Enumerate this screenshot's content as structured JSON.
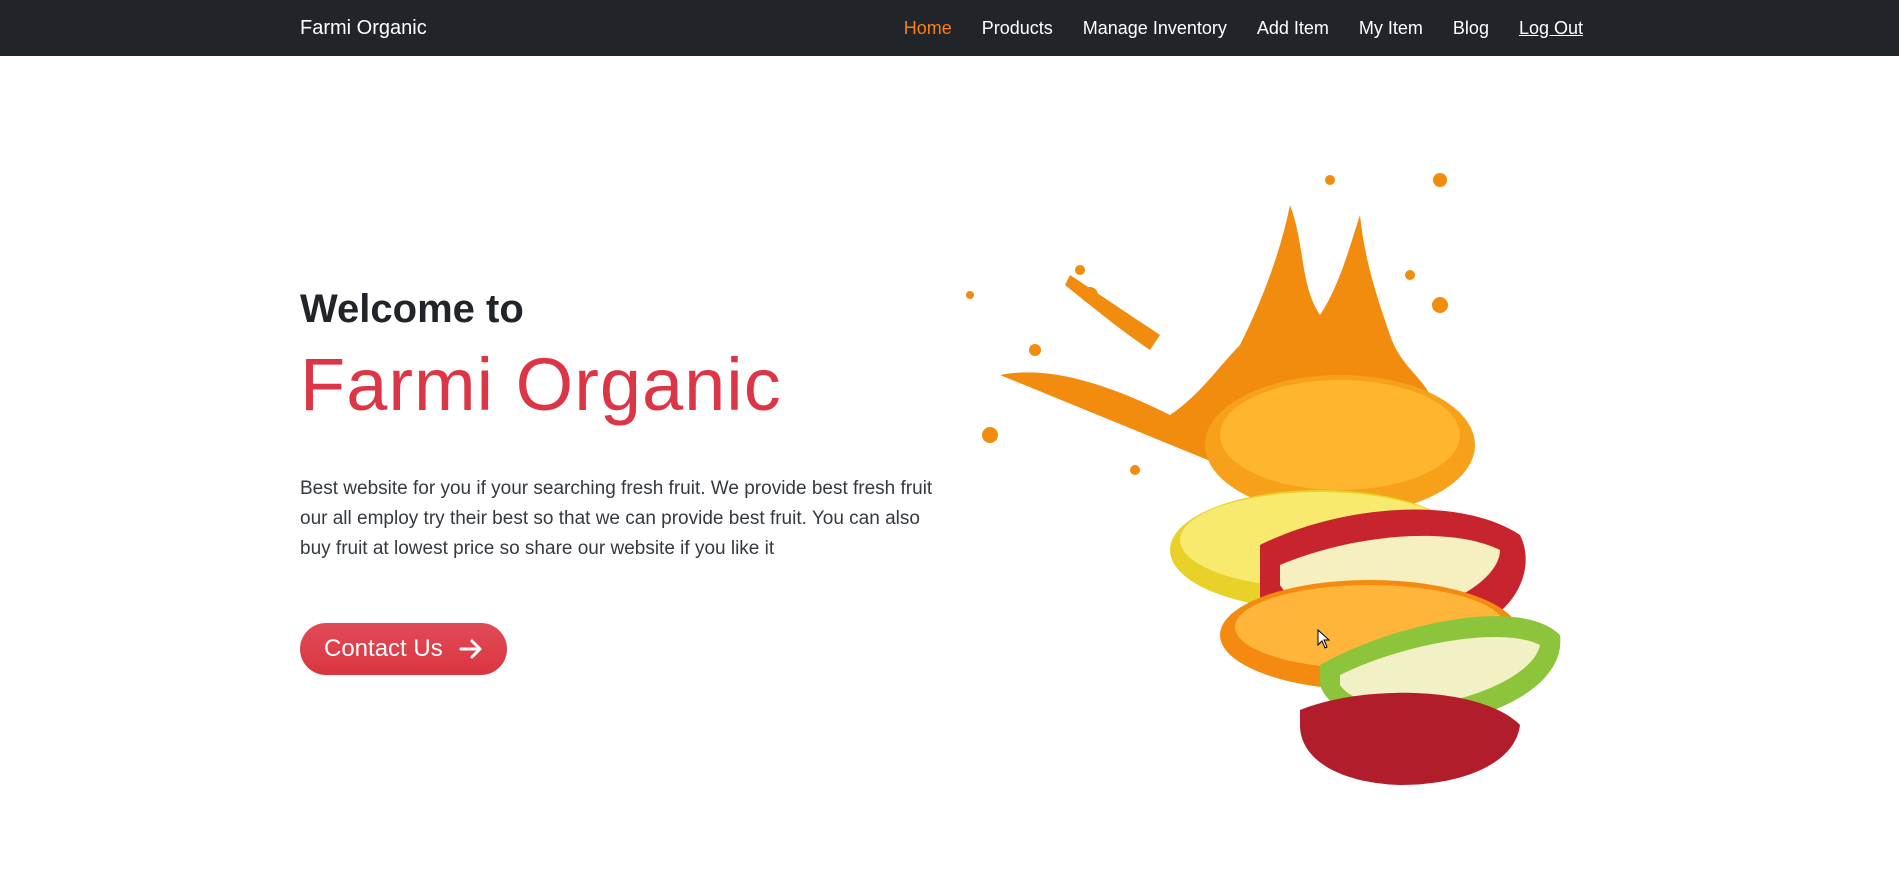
{
  "navbar": {
    "brand": "Farmi Organic",
    "links": [
      {
        "label": "Home",
        "active": true
      },
      {
        "label": "Products"
      },
      {
        "label": "Manage Inventory"
      },
      {
        "label": "Add Item"
      },
      {
        "label": "My Item"
      },
      {
        "label": "Blog"
      },
      {
        "label": "Log Out"
      }
    ]
  },
  "hero": {
    "welcome": "Welcome to",
    "title": "Farmi Organic",
    "description": "Best website for you if your searching fresh fruit. We provide best fresh fruit our all employ try their best so that we can provide best fruit. You can also buy fruit at lowest price so share our website if you like it",
    "button_label": "Contact Us",
    "button_icon": "arrow-right-icon",
    "image": "fruit-slices-juice-splash"
  },
  "colors": {
    "navbar_bg": "#212529",
    "active_link": "#fd7e14",
    "accent": "#dc3545"
  }
}
